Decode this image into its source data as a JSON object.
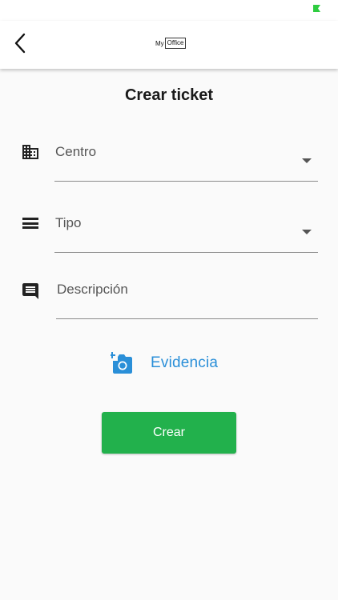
{
  "status_bar": {
    "battery_icon": "battery-icon",
    "battery_color": "#2ecc40"
  },
  "app_bar": {
    "back_icon": "chevron-left-icon",
    "brand_part1": "My",
    "brand_part2": "Office"
  },
  "page": {
    "title": "Crear ticket"
  },
  "form": {
    "centro": {
      "label": "Centro",
      "icon": "building-icon"
    },
    "tipo": {
      "label": "Tipo",
      "icon": "list-lines-icon"
    },
    "descripcion": {
      "label": "Descripción",
      "icon": "comment-icon"
    },
    "evidence": {
      "label": "Evidencia",
      "icon": "add-photo-icon"
    },
    "submit": {
      "label": "Crear"
    }
  },
  "colors": {
    "accent_blue": "#2a8fd8",
    "primary_green": "#22b14c",
    "background": "#fafafa"
  }
}
